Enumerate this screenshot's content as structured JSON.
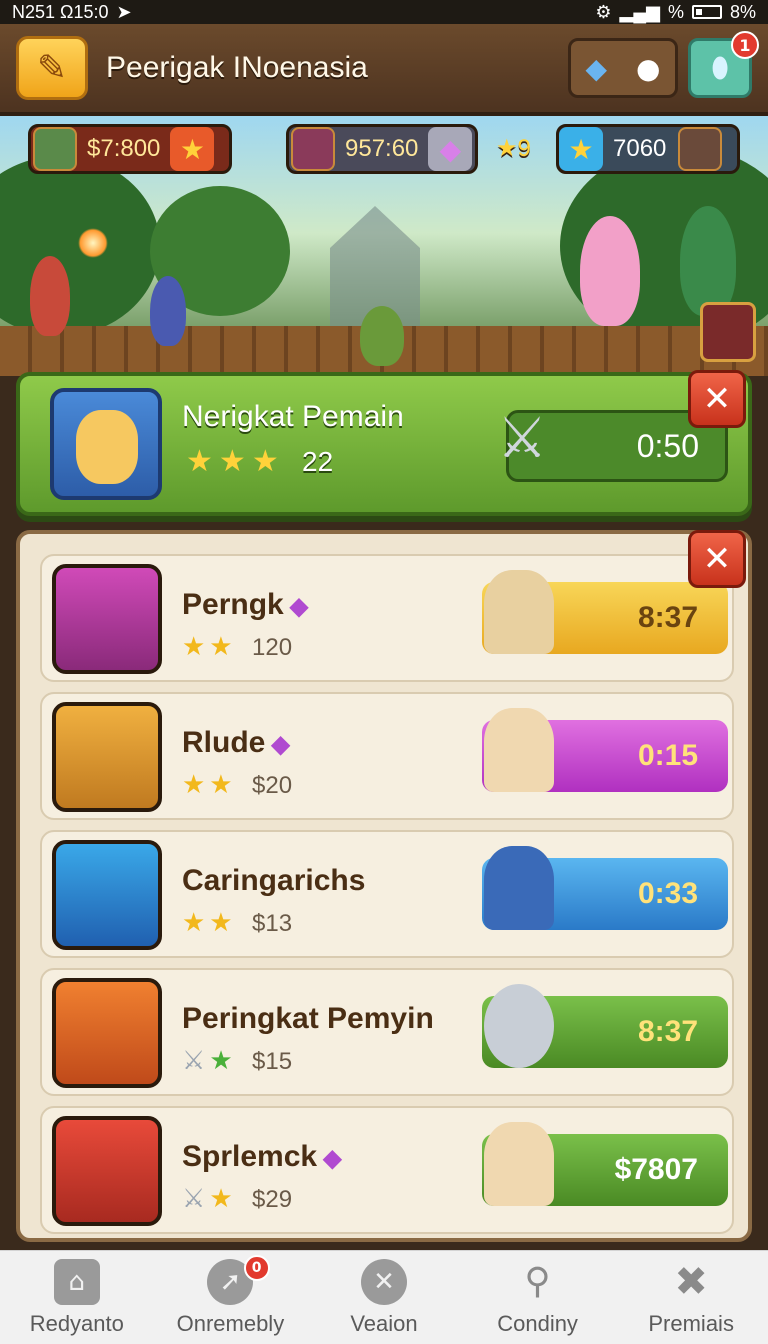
{
  "status_bar": {
    "left_text": "N251 Ω15:0",
    "right_text": "% ",
    "battery_text": "8%"
  },
  "header": {
    "title": "Peerigak INoenasia",
    "notification_count": "1"
  },
  "resources": {
    "gold": "$7:800",
    "gems": "957:60",
    "stars": "9",
    "trophies": "7060"
  },
  "featured": {
    "title": "Nerigkat Pemain",
    "count": "22",
    "timer": "0:50",
    "close_label": "✕"
  },
  "list": {
    "close_label": "✕",
    "rows": [
      {
        "name": "Perngk",
        "price": "120",
        "timer": "8:37"
      },
      {
        "name": "Rlude",
        "price": "$20",
        "timer": "0:15"
      },
      {
        "name": "Caringarichs",
        "price": "$13",
        "timer": "0:33"
      },
      {
        "name": "Peringkat Pemyin",
        "price": "$15",
        "timer": "8:37"
      },
      {
        "name": "Sprlemck",
        "price": "$29",
        "timer": "$7807"
      }
    ]
  },
  "nav": {
    "items": [
      {
        "label": "Redyanto"
      },
      {
        "label": "Onremebly",
        "badge": "0"
      },
      {
        "label": "Veaion"
      },
      {
        "label": "Condiny"
      },
      {
        "label": "Premiais"
      }
    ]
  },
  "colors": {
    "timer_yellow": "#f2c23a",
    "timer_purple": "#c948d0",
    "timer_blue": "#3a92d8",
    "timer_green": "#5fa232"
  }
}
